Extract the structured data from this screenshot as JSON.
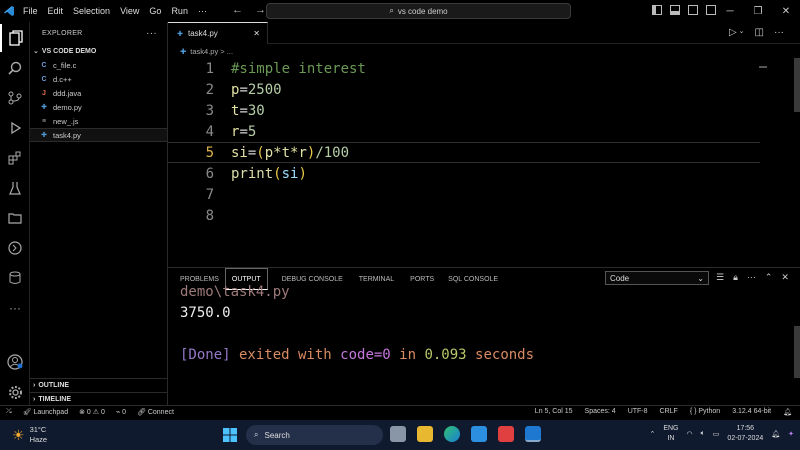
{
  "titlebar": {
    "menu": [
      "File",
      "Edit",
      "Selection",
      "View",
      "Go",
      "Run",
      "···"
    ],
    "search_text": "vs code demo"
  },
  "sidebar": {
    "header": "EXPLORER",
    "folder": "VS CODE DEMO",
    "files": [
      {
        "icon": "C",
        "name": "c_file.c",
        "color": "#6f9ed6"
      },
      {
        "icon": "C",
        "name": "d.c++",
        "color": "#6f9ed6"
      },
      {
        "icon": "J",
        "name": "ddd.java",
        "color": "#e06c4c"
      },
      {
        "icon": "✚",
        "name": "demo.py",
        "color": "#4e9ad6"
      },
      {
        "icon": "≡",
        "name": "new_.js",
        "color": "#aaaaaa"
      },
      {
        "icon": "✚",
        "name": "task4.py",
        "color": "#4e9ad6"
      }
    ],
    "outline": "OUTLINE",
    "timeline": "TIMELINE"
  },
  "editor": {
    "tab": "task4.py",
    "breadcrumb": "task4.py > ...",
    "lines": [
      {
        "n": "1"
      },
      {
        "n": "2"
      },
      {
        "n": "3"
      },
      {
        "n": "4"
      },
      {
        "n": "5"
      },
      {
        "n": "6"
      },
      {
        "n": "7"
      },
      {
        "n": "8"
      }
    ],
    "code": {
      "l1": "#simple interest",
      "l2a": "p",
      "l2b": "=",
      "l2c": "2500",
      "l3a": "t",
      "l3b": "=",
      "l3c": "30",
      "l4a": "r",
      "l4b": "=",
      "l4c": "5",
      "l5a": "si",
      "l5b": "=",
      "l5c": "(",
      "l5d": "p*t*r",
      "l5e": ")",
      "l5f": "/100",
      "l6a": "print",
      "l6b": "(",
      "l6c": "si",
      "l6d": ")"
    }
  },
  "panel": {
    "tabs": [
      "PROBLEMS",
      "OUTPUT",
      "DEBUG CONSOLE",
      "TERMINAL",
      "PORTS",
      "SQL CONSOLE"
    ],
    "select_value": "Code",
    "output": {
      "path": "demo\\task4.py",
      "value": "3750.0",
      "done": "[Done]",
      "exited": " exited with ",
      "code": "code=0",
      "in": " in ",
      "seconds": "0.093",
      "unit": " seconds"
    }
  },
  "status": {
    "launchpad": "Launchpad",
    "errors": "0",
    "warnings": "0",
    "ports": "0",
    "connect": "Connect",
    "position": "Ln 5, Col 15",
    "spaces": "Spaces: 4",
    "encoding": "UTF-8",
    "eol": "CRLF",
    "language": "Python",
    "interpreter": "3.12.4 64-bit"
  },
  "taskbar": {
    "temp": "31°C",
    "weather": "Haze",
    "search": "Search",
    "lang1": "ENG",
    "lang2": "IN",
    "time": "17:56",
    "date": "02-07-2024"
  }
}
